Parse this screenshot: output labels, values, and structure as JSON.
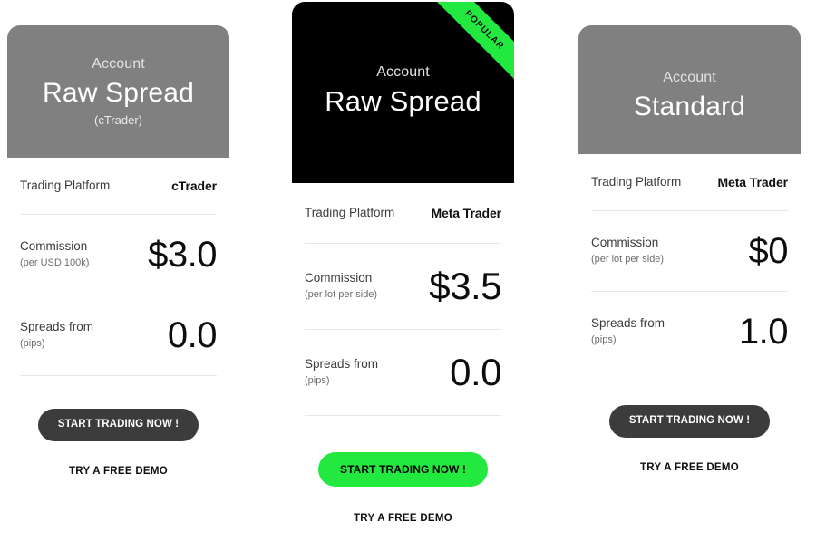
{
  "theme": {
    "gray_header": "#808080",
    "black_header": "#000000",
    "accent_green": "#23e83f",
    "dark_button": "#3c3c3c",
    "divider": "#e7e7e7"
  },
  "cards": [
    {
      "kicker": "Account",
      "title": "Raw Spread",
      "subtitle": "(cTrader)",
      "ribbon": null,
      "rows": {
        "platform_label": "Trading Platform",
        "platform_value": "cTrader",
        "commission_label": "Commission",
        "commission_sub": "(per USD 100k)",
        "commission_value": "$3.0",
        "spreads_label": "Spreads from",
        "spreads_sub": "(pips)",
        "spreads_value": "0.0"
      },
      "cta_label": "START TRADING NOW !",
      "demo_label": "TRY A FREE DEMO"
    },
    {
      "kicker": "Account",
      "title": "Raw Spread",
      "subtitle": null,
      "ribbon": "POPULAR",
      "rows": {
        "platform_label": "Trading Platform",
        "platform_value": "Meta Trader",
        "commission_label": "Commission",
        "commission_sub": "(per lot per side)",
        "commission_value": "$3.5",
        "spreads_label": "Spreads from",
        "spreads_sub": "(pips)",
        "spreads_value": "0.0"
      },
      "cta_label": "START TRADING NOW !",
      "demo_label": "TRY A FREE DEMO"
    },
    {
      "kicker": "Account",
      "title": "Standard",
      "subtitle": null,
      "ribbon": null,
      "rows": {
        "platform_label": "Trading Platform",
        "platform_value": "Meta Trader",
        "commission_label": "Commission",
        "commission_sub": "(per lot per side)",
        "commission_value": "$0",
        "spreads_label": "Spreads from",
        "spreads_sub": "(pips)",
        "spreads_value": "1.0"
      },
      "cta_label": "START TRADING NOW !",
      "demo_label": "TRY A FREE DEMO"
    }
  ]
}
